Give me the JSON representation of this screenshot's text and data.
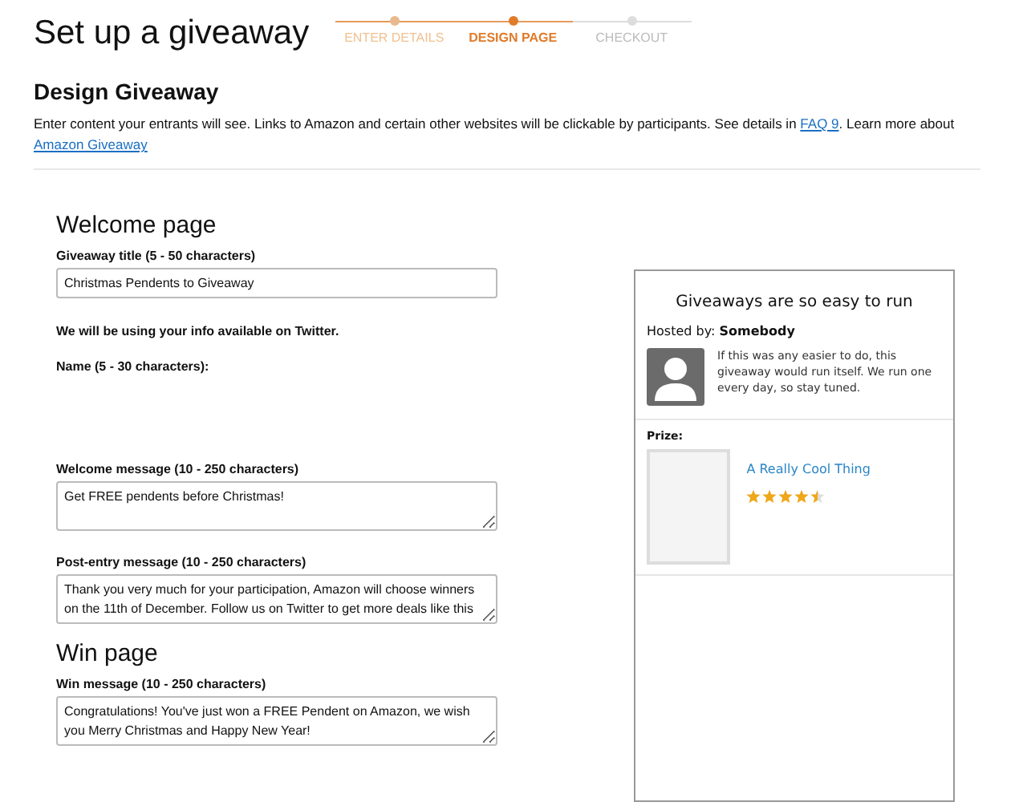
{
  "header": {
    "title": "Set up a giveaway"
  },
  "steps": [
    {
      "label": "ENTER DETAILS",
      "done": true,
      "selected": false
    },
    {
      "label": "DESIGN PAGE",
      "done": true,
      "selected": true
    },
    {
      "label": "CHECKOUT",
      "done": false,
      "selected": false
    }
  ],
  "section": {
    "title": "Design Giveaway",
    "intro": "Enter content your entrants will see. Links to Amazon and certain other websites will be clickable by participants. See details in ",
    "faq_link": "FAQ 9",
    "intro_after": ". Learn more about ",
    "learn_link": "Amazon Giveaway"
  },
  "welcome_page": {
    "heading": "Welcome page",
    "title_label": "Giveaway title (5 - 50 characters)",
    "title_value": "Christmas Pendents to Giveaway",
    "twitter_note": "We will be using your info available on Twitter.",
    "name_label": "Name (5 - 30 characters):",
    "welcome_label": "Welcome message (10 - 250 characters)",
    "welcome_value": "Get FREE pendents before Christmas!",
    "post_label": "Post-entry message (10 - 250 characters)",
    "post_value": "Thank you very much for your participation, Amazon will choose winners on the 11th of December. Follow us on Twitter to get more deals like this"
  },
  "win_page": {
    "heading": "Win page",
    "win_label": "Win message (10 - 250 characters)",
    "win_value": "Congratulations! You've just won a FREE Pendent on Amazon, we wish you Merry Christmas and Happy New Year!"
  },
  "preview": {
    "title": "Giveaways are so easy to run",
    "hosted": "Hosted by: **Somebody**",
    "bio": "If this was any easier to do, this giveaway would run itself. We run one every day, so stay tuned.",
    "prize_label": "Prize:",
    "prize_name": "A Really Cool Thing",
    "stars": 4.5
  }
}
